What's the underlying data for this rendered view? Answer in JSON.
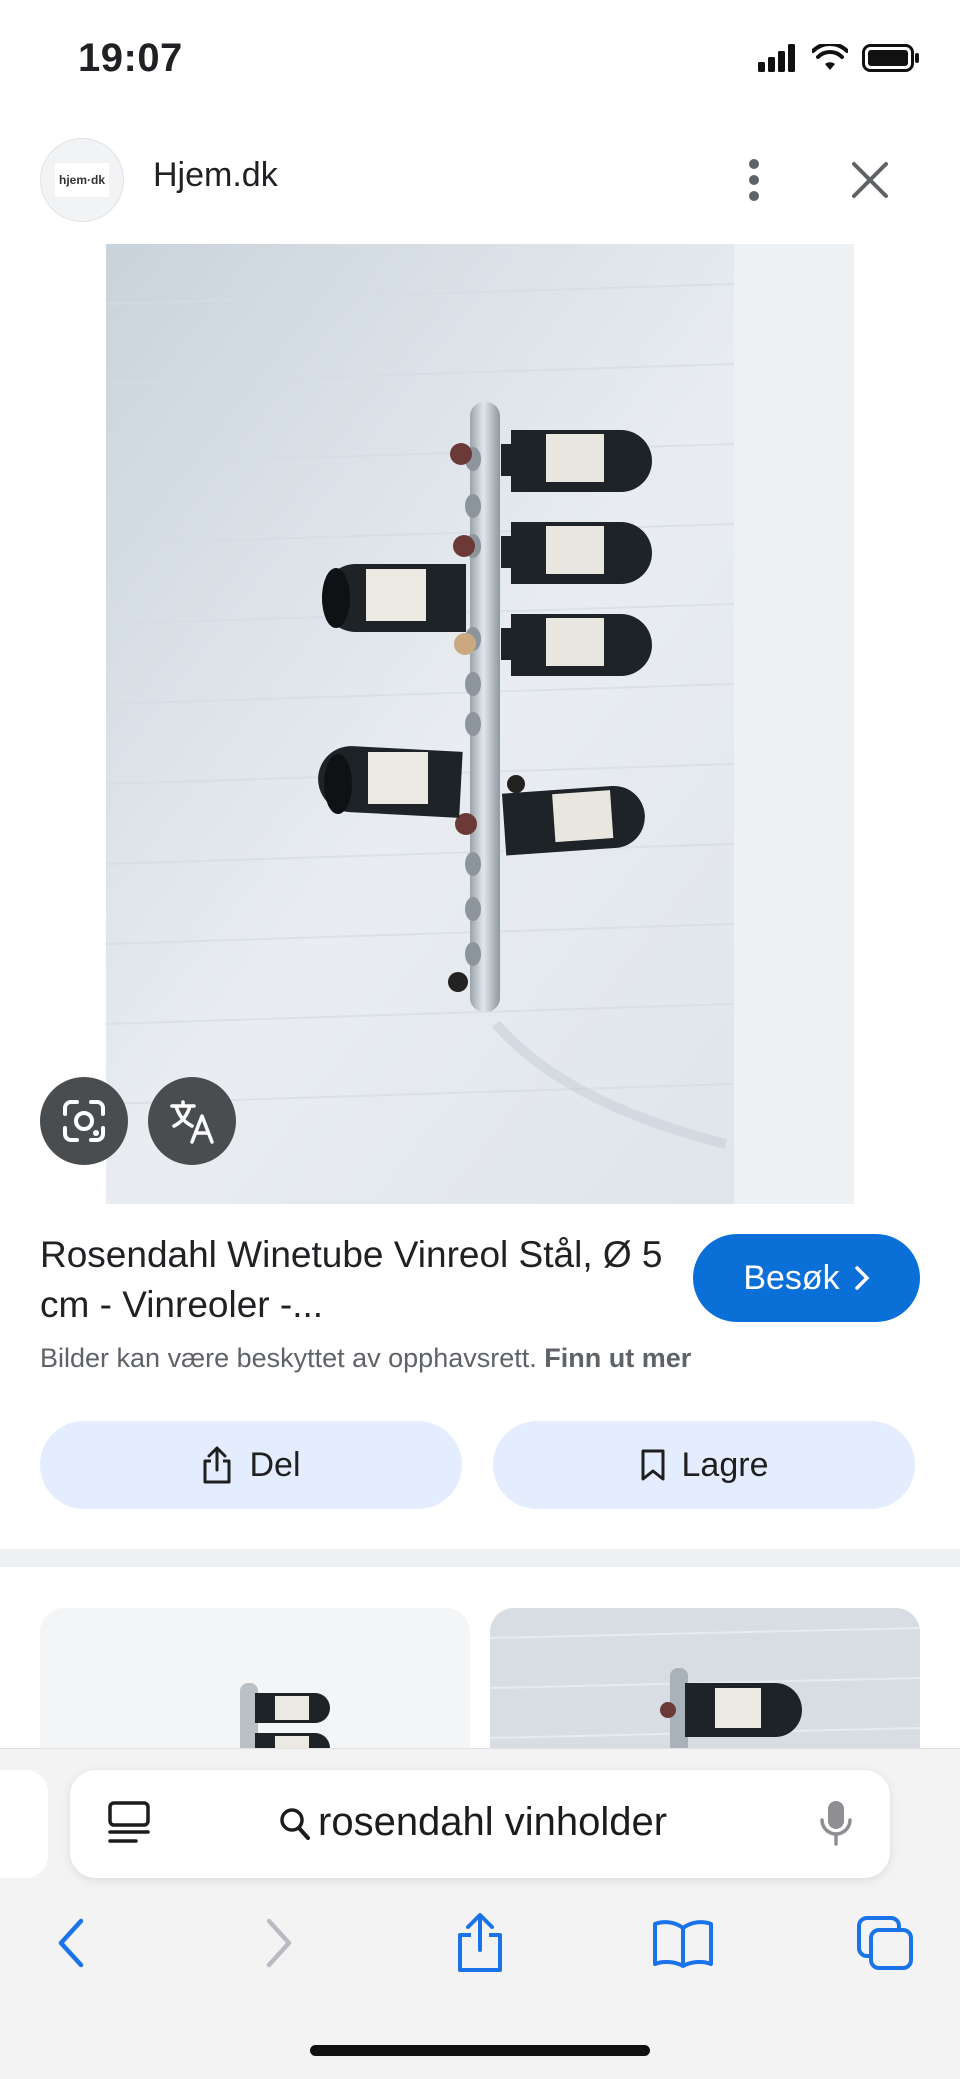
{
  "status_bar": {
    "time": "19:07"
  },
  "site": {
    "logo_text": "hjem·dk",
    "name": "Hjem.dk"
  },
  "result": {
    "title": "Rosendahl Winetube Vinreol Stål, Ø 5 cm - Vinreoler -...",
    "visit_label": "Besøk",
    "copyright_text": "Bilder kan være beskyttet av opphavsrett.",
    "learn_more_label": "Finn ut mer",
    "share_label": "Del",
    "save_label": "Lagre"
  },
  "browser": {
    "search_text": "rosendahl vinholder"
  },
  "icons": {
    "more": "more-vert-icon",
    "close": "close-icon",
    "lens": "google-lens-icon",
    "translate": "translate-icon",
    "share": "share-icon",
    "bookmark": "bookmark-icon",
    "reader": "reader-mode-icon",
    "search": "search-icon",
    "mic": "microphone-icon",
    "back": "back-chevron-icon",
    "forward": "forward-chevron-icon",
    "safari_share": "share-icon",
    "bookmarks": "book-icon",
    "tabs": "tabs-icon"
  },
  "colors": {
    "accent": "#0b6fd8",
    "button_bg": "#e3edfd",
    "chrome_blue": "#1a73e8"
  }
}
